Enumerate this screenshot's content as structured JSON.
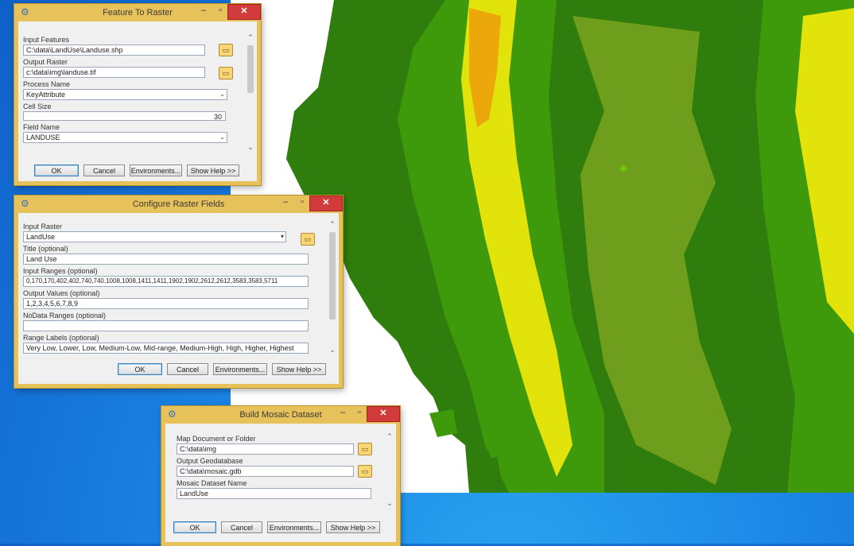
{
  "colors": {
    "map_dark": "#2f7d0c",
    "map_green": "#3e9a0a",
    "map_olive": "#6f9d1c",
    "map_light": "#6dc40a",
    "map_yellow": "#e2e30a",
    "map_orange": "#eca70a",
    "window_frame": "#e7c25a",
    "close_button": "#d13b3b"
  },
  "feature_to_raster": {
    "title": "Feature To Raster",
    "input_features_label": "Input Features",
    "input_features_value": "C:\\data\\LandUse\\Landuse.shp",
    "output_raster_label": "Output Raster",
    "output_raster_value": "c:\\data\\img\\landuse.tif",
    "process_name_label": "Process Name",
    "process_name_value": "KeyAttribute",
    "cell_size_label": "Cell Size",
    "cell_size_value": "30",
    "field_name_label": "Field Name",
    "field_name_value": "LANDUSE",
    "buttons": {
      "ok": "OK",
      "cancel": "Cancel",
      "environments": "Environments...",
      "show_help": "Show Help >>"
    }
  },
  "configure_raster_fields": {
    "title": "Configure Raster Fields",
    "input_raster_label": "Input Raster",
    "input_raster_value": "LandUse",
    "title_label": "Title (optional)",
    "title_value": "Land Use",
    "input_ranges_label": "Input Ranges (optional)",
    "input_ranges_value": "0,170,170,402,402,740,740,1008,1008,1411,1411,1902,1902,2612,2612,3583,3583,5711",
    "output_values_label": "Output Values (optional)",
    "output_values_value": "1,2,3,4,5,6,7,8,9",
    "nodata_ranges_label": "NoData Ranges (optional)",
    "nodata_ranges_value": "",
    "range_labels_label": "Range Labels (optional)",
    "range_labels_value": "Very Low, Lower, Low, Medium-Low, Mid-range, Medium-High, High, Higher, Highest",
    "buttons": {
      "ok": "OK",
      "cancel": "Cancel",
      "environments": "Environments...",
      "show_help": "Show Help >>"
    }
  },
  "build_mosaic_dataset": {
    "title": "Build Mosaic Dataset",
    "map_doc_label": "Map Document or Folder",
    "map_doc_value": "C:\\data\\img",
    "output_gdb_label": "Output Geodatabase",
    "output_gdb_value": "C:\\data\\mosaic.gdb",
    "mosaic_name_label": "Mosaic Dataset Name",
    "mosaic_name_value": "LandUse",
    "buttons": {
      "ok": "OK",
      "cancel": "Cancel",
      "environments": "Environments...",
      "show_help": "Show Help >>"
    }
  }
}
